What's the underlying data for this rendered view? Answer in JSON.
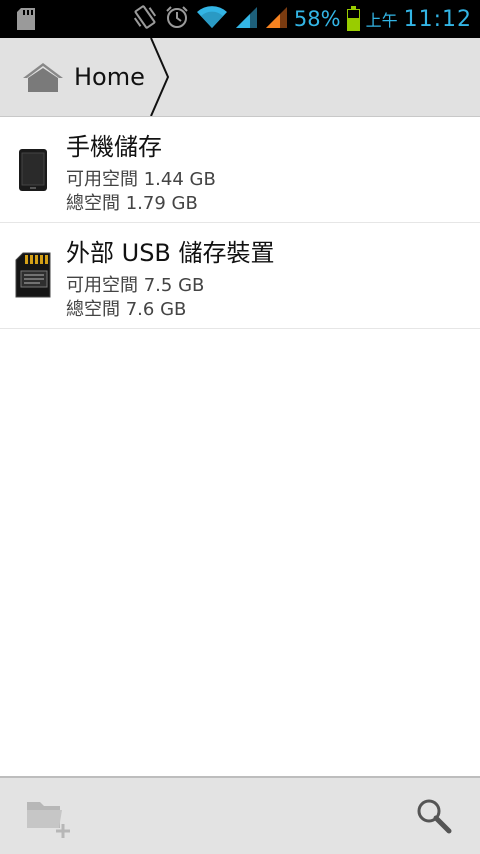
{
  "status_bar": {
    "battery_percent": "58%",
    "battery_level": 0.58,
    "time_prefix": "上午",
    "time": "11:12",
    "icons": [
      "sdcard-icon",
      "vibrate-icon",
      "alarm-icon",
      "wifi-icon",
      "signal-1-icon",
      "signal-2-icon",
      "battery-icon"
    ],
    "accent_color": "#33b5e5"
  },
  "breadcrumb": {
    "home_label": "Home",
    "home_icon": "home-icon"
  },
  "storage": [
    {
      "icon": "phone-icon",
      "name": "手機儲存",
      "available": "可用空間 1.44 GB",
      "total": "總空間 1.79 GB"
    },
    {
      "icon": "sdcard-icon",
      "name": "外部 USB 儲存裝置",
      "available": "可用空間 7.5 GB",
      "total": "總空間 7.6 GB"
    }
  ],
  "bottom_bar": {
    "new_folder_icon": "new-folder-icon",
    "search_icon": "search-icon"
  }
}
